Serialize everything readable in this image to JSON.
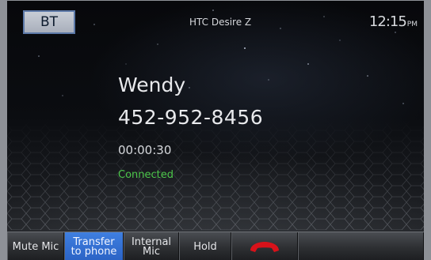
{
  "header": {
    "bt_label": "BT",
    "device_name": "HTC Desire Z",
    "time": "12:15",
    "ampm": "PM"
  },
  "call": {
    "caller_name": "Wendy",
    "caller_number": "452-952-8456",
    "duration": "00:00:30",
    "status": "Connected",
    "status_color": "#4cc64a"
  },
  "bottom_bar": {
    "mute_mic": "Mute Mic",
    "transfer_line1": "Transfer",
    "transfer_line2": "to phone",
    "internal_line1": "Internal",
    "internal_line2": "Mic",
    "hold": "Hold",
    "end_call_icon": "hang-up-icon",
    "end_call_color": "#d8121a",
    "active_color": "#2a62c4"
  }
}
